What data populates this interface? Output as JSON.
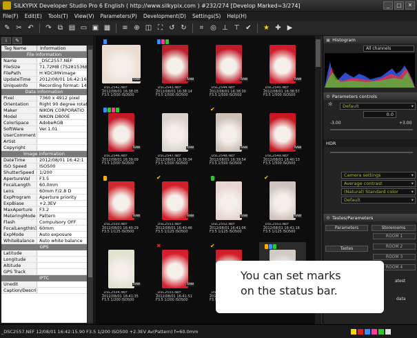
{
  "window": {
    "title": "SILKYPIX Developer Studio Pro 6 English ( http://www.silkypix.com )  #232/274 [Develop Marked=3/274]"
  },
  "menu": [
    "File(F)",
    "Edit(E)",
    "Tools(T)",
    "View(V)",
    "Parameters(P)",
    "Development(D)",
    "Settings(S)",
    "Help(H)"
  ],
  "toolbar": [
    "wrench-icon",
    "scissors-icon",
    "undo-icon",
    "redo-icon",
    "copy-icon",
    "paste-icon",
    "folder-icon",
    "image-icon",
    "grid-icon",
    "list-icon",
    "zoom-icon",
    "compare-icon",
    "fullscreen-icon",
    "rotate-left-icon",
    "rotate-right-icon",
    "crop-icon",
    "spot-icon",
    "straighten-icon",
    "level-icon",
    "check-icon",
    "star-icon",
    "puzzle-icon",
    "develop-icon"
  ],
  "info": {
    "col_tag": "Tag Name",
    "col_info": "Information",
    "sections": [
      {
        "title": "File information",
        "rows": [
          [
            "Name",
            "_DSC2557.NEF"
          ],
          [
            "FileSize",
            "71.72MB (75281536By"
          ],
          [
            "FilePath",
            "H:¥DCIM¥image"
          ],
          [
            "UpdateTime",
            "2012/08/01 16:42:16"
          ],
          [
            "UniqueInfo",
            "Recording format: 14b"
          ]
        ]
      },
      {
        "title": "Data information",
        "rows": [
          [
            "Pixel",
            "7360 x 4912 pixel"
          ],
          [
            "Orientation",
            "Right 90 degree rotat"
          ],
          [
            "Maker",
            "NIKON CORPORATIO"
          ],
          [
            "Model",
            "NIKON D800E"
          ],
          [
            "ColorSpace",
            "AdobeRGB"
          ],
          [
            "SoftWare",
            "Ver.1.01"
          ],
          [
            "UserComment",
            ""
          ],
          [
            "Artist",
            ""
          ],
          [
            "Copyright",
            ""
          ]
        ]
      },
      {
        "title": "Image information",
        "rows": [
          [
            "DateTime",
            "2012/08/01 16:42:1"
          ],
          [
            "ISO Speed",
            "ISO500"
          ],
          [
            "ShutterSpeed",
            "1/200"
          ],
          [
            "ApertureVal",
            "F3.5"
          ],
          [
            "FocalLength",
            "60.0mm"
          ],
          [
            "Lens",
            "60mm F/2.8 D"
          ],
          [
            "ExpProgram",
            "Aperture priority"
          ],
          [
            "ExpBiase",
            "+2.3EV"
          ],
          [
            "MaxAperture",
            "F3.2"
          ],
          [
            "MeteringMode",
            "Pattern"
          ],
          [
            "Flash",
            "Compulsory OFF"
          ],
          [
            "FocalLengthIn35",
            "60mm"
          ],
          [
            "ExpMode",
            "Auto exposure"
          ],
          [
            "WhiteBalance",
            "Auto white balance"
          ]
        ]
      },
      {
        "title": "GPS",
        "rows": [
          [
            "Latitude",
            ""
          ],
          [
            "Longitude",
            ""
          ],
          [
            "Altitude",
            ""
          ],
          [
            "GPS Track",
            ""
          ]
        ]
      },
      {
        "title": "IPTC",
        "rows": [
          [
            "Unedit",
            ""
          ],
          [
            "Caption/Descri",
            ""
          ]
        ]
      }
    ]
  },
  "thumbs": [
    {
      "cap": "_DSC2542.NEF\n2012/08/01 16:38:05\nF3.5 1/500 ISO500",
      "col": "#e9dcd0",
      "marks": [
        "#3a8dff"
      ],
      "check": false,
      "x": false,
      "port": false
    },
    {
      "cap": "_DSC2543.NEF\n2012/08/01 16:38:14\nF3.5 1/500 ISO500",
      "col": "#b8202a",
      "marks": [
        "#3a8dff",
        "#ff3aa0",
        "#2ec72e"
      ],
      "check": false,
      "x": false,
      "port": true
    },
    {
      "cap": "_DSC2544.NEF\n2012/08/01 16:38:30\nF3.5 1/500 ISO500",
      "col": "#c01a2a",
      "marks": [],
      "check": false,
      "x": false,
      "port": true
    },
    {
      "cap": "_DSC2545.NEF\n2012/08/01 16:38:57\nF3.5 1/500 ISO500",
      "col": "#d01c2c",
      "marks": [],
      "check": false,
      "x": false,
      "port": true
    },
    {
      "cap": "_DSC2546.NEF\n2012/08/01 16:39:09\nF3.5 1/500 ISO500",
      "col": "#c41826",
      "marks": [
        "#3a8dff",
        "#2ec72e",
        "#ff3aa0",
        "#2ec72e"
      ],
      "check": false,
      "x": false,
      "port": true
    },
    {
      "cap": "_DSC2547.NEF\n2012/08/01 16:39:34\nF3.5 1/500 ISO500",
      "col": "#d9d2cd",
      "marks": [],
      "check": false,
      "x": false,
      "port": true
    },
    {
      "cap": "_DSC2548.NEF\n2012/08/01 16:39:54\nF3.5 1/500 ISO500",
      "col": "#cdbfb5",
      "marks": [],
      "check": true,
      "x": false,
      "port": true
    },
    {
      "cap": "_DSC2549.NEF\n2012/08/01 16:40:13\nF3.5 1/500 ISO500",
      "col": "#c7161f",
      "marks": [],
      "check": false,
      "x": false,
      "port": true
    },
    {
      "cap": "_DSC2550.NEF\n2012/08/01 16:40:29\nF3.5 1/125 ISO500",
      "col": "#d02a30",
      "marks": [
        "#ffb000"
      ],
      "check": false,
      "x": false,
      "port": true
    },
    {
      "cap": "_DSC2551.NEF\n2012/08/01 16:40:46\nF3.5 1/125 ISO500",
      "col": "#d41e2a",
      "marks": [],
      "check": true,
      "x": false,
      "port": true
    },
    {
      "cap": "_DSC2552.NEF\n2012/08/01 16:41:06\nF3.5 1/125 ISO500",
      "col": "#e7d5cf",
      "marks": [
        "#2ec72e"
      ],
      "check": false,
      "x": false,
      "port": true
    },
    {
      "cap": "_DSC2553.NEF\n2012/08/01 16:41:16\nF3.5 1/125 ISO500",
      "col": "#cfc4bd",
      "marks": [],
      "check": true,
      "x": false,
      "port": true
    },
    {
      "cap": "_DSC2554.NEF\n2012/08/01 16:41:35\nF3.5 1/200 ISO500",
      "col": "#e0e2d0",
      "marks": [],
      "check": false,
      "x": false,
      "port": true
    },
    {
      "cap": "_DSC2555.NEF\n2012/08/01 16:41:51\nF3.5 1/200 ISO500",
      "col": "#d61f2e",
      "marks": [],
      "check": false,
      "x": true,
      "port": true
    },
    {
      "cap": "_DSC2556.NEF\n2012/08/01 16:42:03\nF3.5 1/200 ISO500",
      "col": "#cf1d28",
      "marks": [],
      "check": true,
      "x": false,
      "port": true
    },
    {
      "cap": "_DSC2557.NEF\n2012/08/01 16:42:15\nF3.5 1/200 ISO500",
      "col": "#d0c9c4",
      "marks": [
        "#ffb000",
        "#3a8dff",
        "#2ec72e"
      ],
      "check": false,
      "x": false,
      "port": true,
      "sel": true
    }
  ],
  "histogram": {
    "title": "Histogram",
    "channel": "All channels"
  },
  "params": {
    "title": "Parameters controls",
    "preset": "Default",
    "ev": "0.0",
    "ev_min": "-3.00",
    "ev_max": "+3.00",
    "hdr": "HDR",
    "wb": "Camera settings",
    "contrast": "Average contrast",
    "color": "(Natural) Standard color",
    "sharp": "Default"
  },
  "tastes": {
    "title": "Tastes/Parameters",
    "parameters": "Parameters",
    "storerooms": "Storerooms",
    "tastes": "Tastes",
    "rooms": [
      "ROOM 1",
      "ROOM 2",
      "ROOM 3",
      "ROOM 4"
    ],
    "latest": "atest",
    "data": "data"
  },
  "toast": "You can set marks\non the status bar.",
  "status": {
    "text": "_DSC2557.NEF 12/08/01 16:42:15.90 F3.5 1/200 ISO500 +2.3EV Av(Pattern) f=60.0mm",
    "marks": [
      "#ffd200",
      "#e02020",
      "#3a8dff",
      "#ff3aa0",
      "#2ec72e",
      "#dddddd"
    ]
  }
}
